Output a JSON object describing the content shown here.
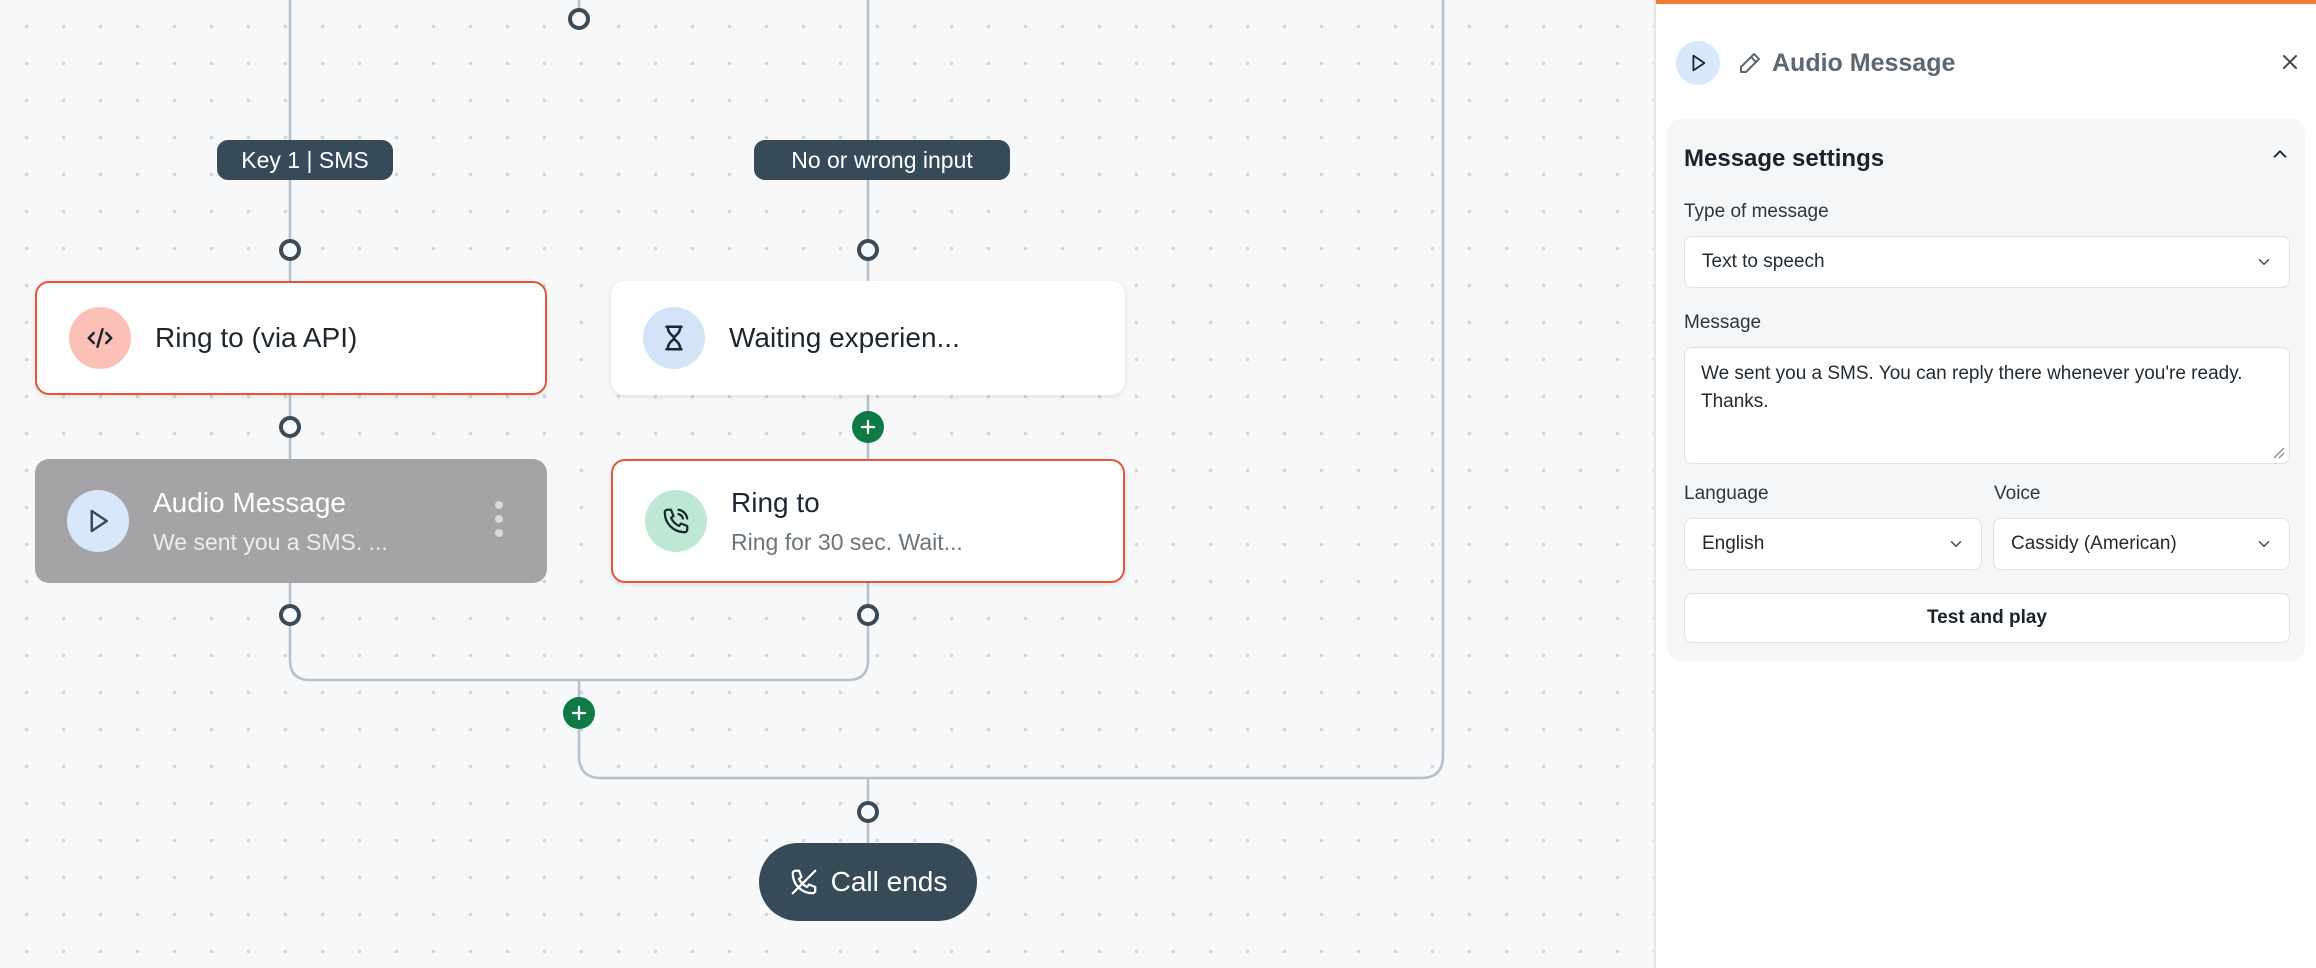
{
  "canvas": {
    "edge_labels": {
      "key1": "Key 1 | SMS",
      "no_input": "No or wrong input"
    },
    "nodes": {
      "ring_api": {
        "title": "Ring to (via API)",
        "icon": "code-icon"
      },
      "waiting": {
        "title": "Waiting experien...",
        "icon": "hourglass-icon"
      },
      "audio": {
        "title": "Audio Message",
        "subtitle": "We sent you a SMS. ...",
        "icon": "play-icon"
      },
      "ring_to": {
        "title": "Ring to",
        "subtitle": "Ring for 30 sec. Wait...",
        "icon": "phone-ring-icon"
      }
    },
    "call_ends": "Call ends"
  },
  "panel": {
    "title": "Audio Message",
    "section_title": "Message settings",
    "type_label": "Type of message",
    "type_value": "Text to speech",
    "message_label": "Message",
    "message_value": "We sent you a SMS. You can reply there whenever you're ready. Thanks.",
    "language_label": "Language",
    "language_value": "English",
    "voice_label": "Voice",
    "voice_value": "Cassidy (American)",
    "test_button": "Test and play"
  },
  "colors": {
    "accent_orange": "#f27b3a",
    "node_border_red": "#e4553b",
    "add_green": "#0f7a46",
    "label_dark": "#364a58"
  }
}
